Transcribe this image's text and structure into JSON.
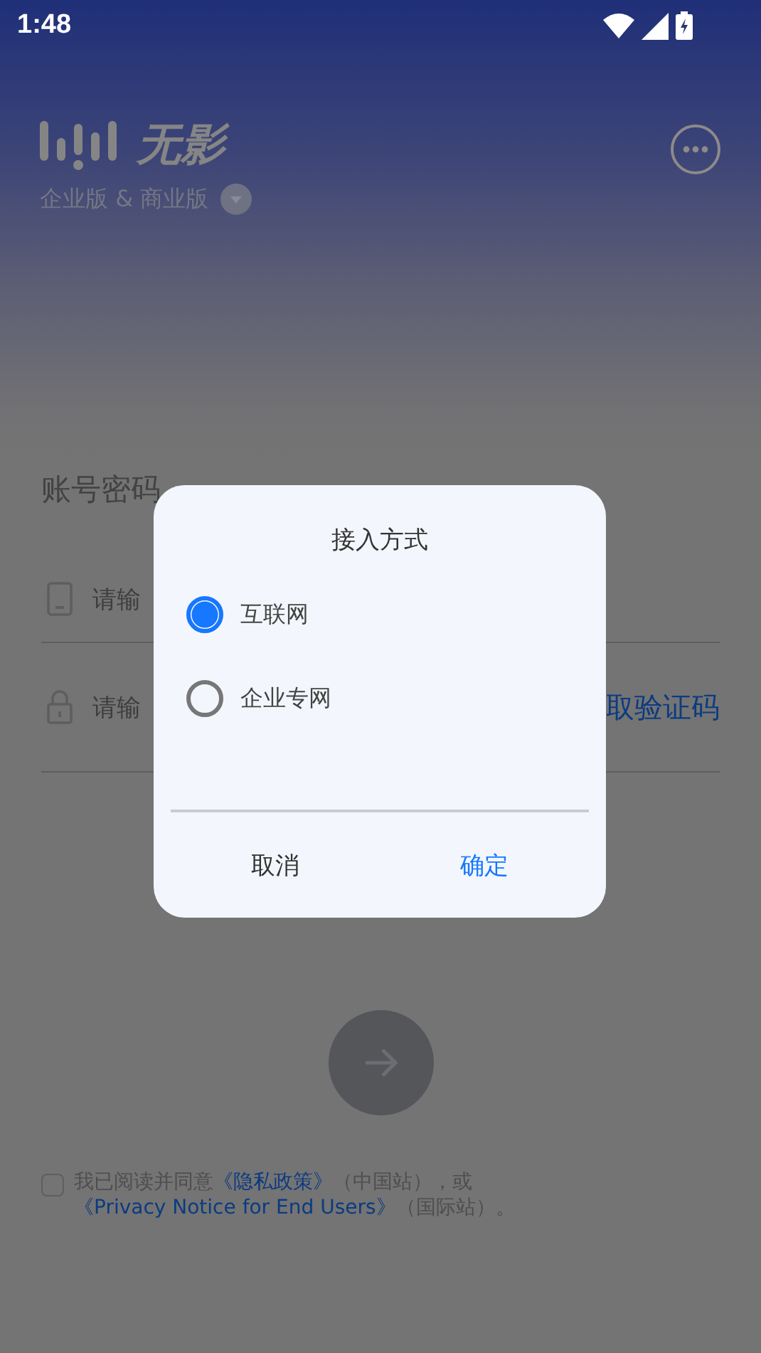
{
  "status_bar": {
    "time": "1:48"
  },
  "brand": {
    "name": "无影",
    "edition": "企业版 & 商业版"
  },
  "login": {
    "tab_label": "账号密码",
    "fields": [
      {
        "kind": "phone",
        "placeholder": "请输"
      },
      {
        "kind": "code",
        "placeholder": "请输",
        "action": "取验证码"
      }
    ]
  },
  "agreement": {
    "checked": false,
    "parts": [
      {
        "kind": "text",
        "text": "我已阅读并同意"
      },
      {
        "kind": "link",
        "text": "《隐私政策》"
      },
      {
        "kind": "text",
        "text": "（中国站），或"
      },
      {
        "kind": "link",
        "text": "《Privacy Notice for End Users》"
      },
      {
        "kind": "text",
        "text": "（国际站）。"
      }
    ]
  },
  "dialog": {
    "title": "接入方式",
    "options": [
      {
        "label": "互联网",
        "selected": true
      },
      {
        "label": "企业专网",
        "selected": false
      }
    ],
    "buttons": [
      {
        "label": "取消",
        "kind": "cancel"
      },
      {
        "label": "确定",
        "kind": "confirm"
      }
    ]
  }
}
